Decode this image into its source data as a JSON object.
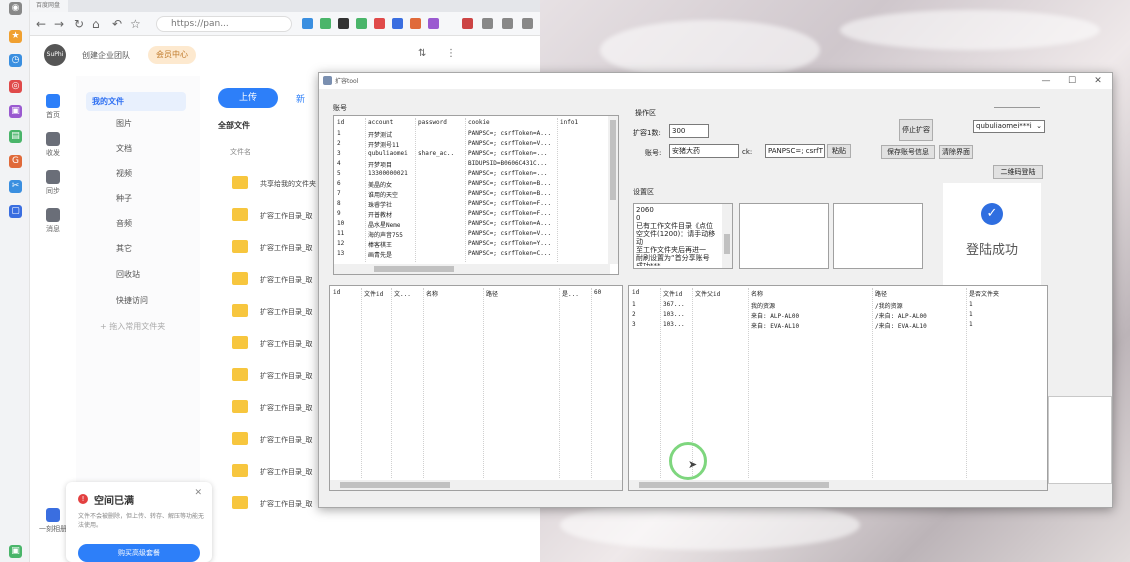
{
  "colors": {
    "accent": "#2d7ff9",
    "folder": "#f7c63e",
    "toast_warn": "#e34040",
    "vip_bg": "#fde9cf",
    "success_icon": "#2f6ee0"
  },
  "browser": {
    "tab_title": "百度网盘",
    "url": "https://pan...",
    "nav_icons": [
      "back-icon",
      "forward-icon",
      "reload-icon",
      "home-icon",
      "undo-icon",
      "star-icon"
    ]
  },
  "app": {
    "avatar_text": "SuPhi",
    "team_label": "创建企业团队",
    "vip_label": "会员中心",
    "nav": [
      {
        "label": "首页",
        "icon": "home-icon"
      },
      {
        "label": "收发",
        "icon": "inbox-icon"
      },
      {
        "label": "同步",
        "icon": "sync-icon"
      },
      {
        "label": "消息",
        "icon": "message-icon"
      }
    ],
    "sidebar": {
      "my_files": "我的文件",
      "items": [
        "图片",
        "文档",
        "视频",
        "种子",
        "音频",
        "其它"
      ],
      "recycle": "回收站",
      "quick_access": "快捷访问",
      "add_folder": "+ 拖入常用文件夹"
    },
    "file_area": {
      "upload": "上传",
      "new": "新",
      "all_files": "全部文件",
      "col_name": "文件名",
      "files": [
        "共享给我的文件夹",
        "扩容工作目录_取",
        "扩容工作目录_取",
        "扩容工作目录_取",
        "扩容工作目录_取",
        "扩容工作目录_取",
        "扩容工作目录_取",
        "扩容工作目录_取",
        "扩容工作目录_取",
        "扩容工作目录_取",
        "扩容工作目录_取"
      ]
    },
    "bottom_left_label": "一刻相册",
    "toast": {
      "title": "空间已满",
      "desc": "文件不会被删除，但上传、转存、解压等功能无法使用。",
      "button": "购买高级套餐"
    }
  },
  "tool": {
    "title": "扩容tool",
    "accounts_label": "账号",
    "accounts_header": [
      "id",
      "account",
      "password",
      "cookie",
      "info1"
    ],
    "accounts": [
      [
        "1",
        "开梦测试",
        "",
        "PANPSC=; csrfToken=A...",
        ""
      ],
      [
        "2",
        "开梦测号11",
        "",
        "PANPSC=; csrfToken=V...",
        ""
      ],
      [
        "3",
        "qubuliaomei",
        "share_ac..",
        "PANPSC=; csrfToken=...",
        ""
      ],
      [
        "4",
        "开梦项目",
        "",
        "BIDUPSID=B0606C431C...",
        ""
      ],
      [
        "5",
        "13300000021",
        "",
        "PANPSC=; csrfToken=...",
        ""
      ],
      [
        "6",
        "美晶的女",
        "",
        "PANPSC=; csrfToken=B...",
        ""
      ],
      [
        "7",
        "谁用的天空",
        "",
        "PANPSC=; csrfToken=B...",
        ""
      ],
      [
        "8",
        "珠睿学社",
        "",
        "PANPSC=; csrfToken=F...",
        ""
      ],
      [
        "9",
        "开普教材",
        "",
        "PANPSC=; csrfToken=F...",
        ""
      ],
      [
        "10",
        "晶水星Neme",
        "",
        "PANPSC=; csrfToken=A...",
        ""
      ],
      [
        "11",
        "海的声音755",
        "",
        "PANPSC=; csrfToken=V...",
        ""
      ],
      [
        "12",
        "棒客棋王",
        "",
        "PANPSC=; csrfToken=Y...",
        ""
      ],
      [
        "13",
        "画青先是",
        "",
        "PANPSC=; csrfToken=C...",
        ""
      ]
    ],
    "ops_label": "操作区",
    "expand_count_label": "扩容1数:",
    "expand_count_value": "300",
    "account_label": "账号:",
    "account_value": "安猪大药",
    "ck_label": "ck:",
    "ck_value": "PANPSC=; csrfT",
    "paste_btn": "粘贴",
    "stop_btn": "停止扩容",
    "save_btn": "保存账号信息",
    "clear_btn": "清除界面",
    "qr_btn": "二维码登陆",
    "account_select": "qubuliaomei***i",
    "settings_label": "设置区",
    "settings_log": "2060\n0\n已有工作文件目录《点位\n空文件(1200)：请手动移动\n至工作文件夹后再进一\n耐刷设置为“首分享账号\n成功***",
    "login_success": "登陆成功",
    "left_grid_header": [
      "id",
      "文件id",
      "文...",
      "名称",
      "路径",
      "是...",
      "60"
    ],
    "right_grid_header": [
      "id",
      "文件id",
      "文件父id",
      "名称",
      "路径",
      "是否文件夹"
    ],
    "right_grid_rows": [
      [
        "1",
        "367...",
        "",
        "我的资源",
        "/我的资源",
        "1"
      ],
      [
        "2",
        "103...",
        "",
        "来自: ALP-AL00",
        "/来自: ALP-AL00",
        "1"
      ],
      [
        "3",
        "103...",
        "",
        "来自: EVA-AL10",
        "/来自: EVA-AL10",
        "1"
      ]
    ]
  }
}
